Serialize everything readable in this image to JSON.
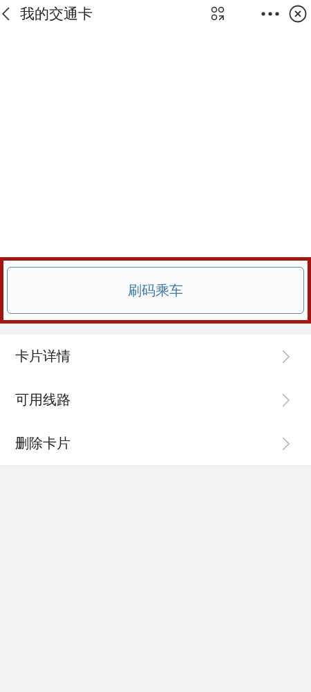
{
  "nav_bar": {
    "title": "我的交通卡"
  },
  "scan_button": {
    "label": "刷码乘车",
    "highlighted": true
  },
  "menu": [
    {
      "label": "卡片详情"
    },
    {
      "label": "可用线路"
    },
    {
      "label": "删除卡片"
    }
  ]
}
